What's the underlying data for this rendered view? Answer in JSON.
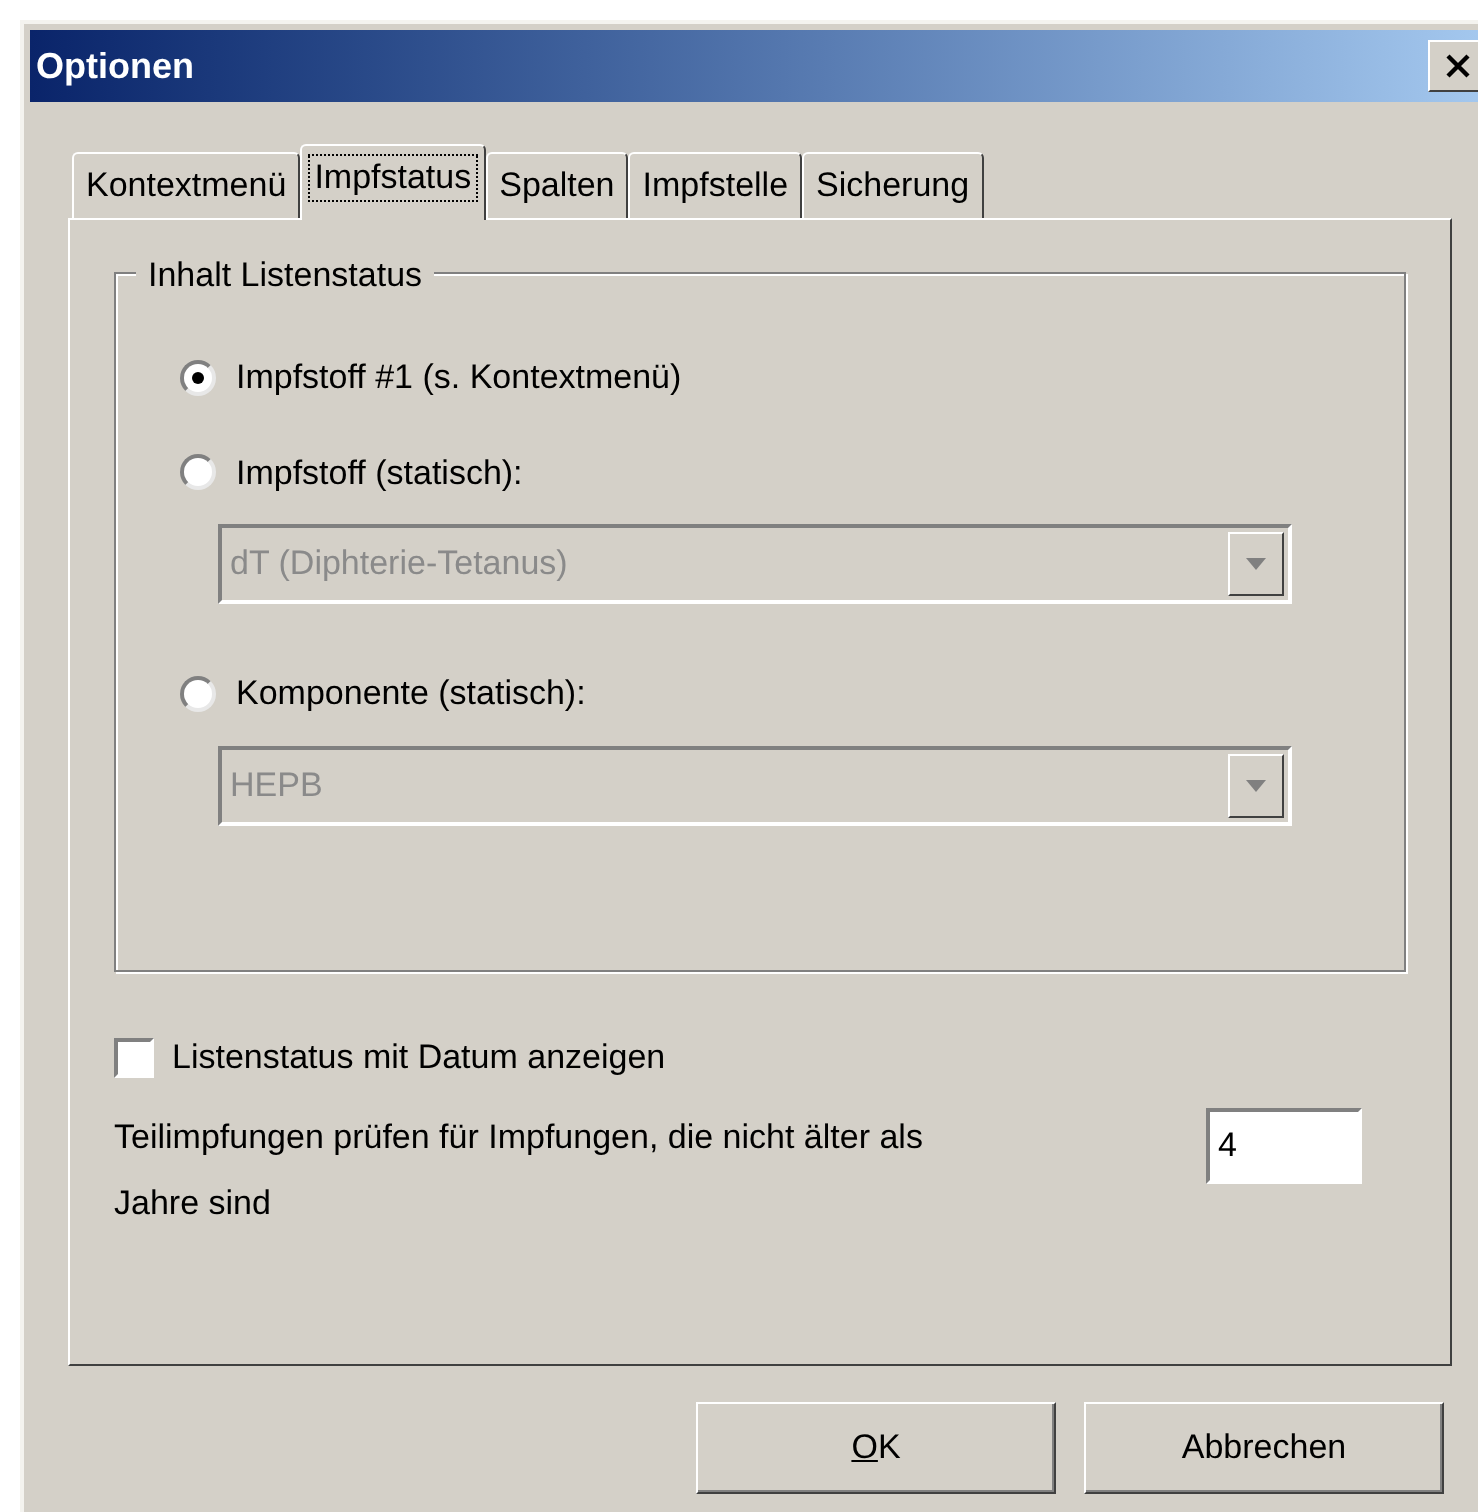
{
  "window": {
    "title": "Optionen"
  },
  "tabs": [
    {
      "label": "Kontextmenü",
      "selected": false
    },
    {
      "label": "Impfstatus",
      "selected": true
    },
    {
      "label": "Spalten",
      "selected": false
    },
    {
      "label": "Impfstelle",
      "selected": false
    },
    {
      "label": "Sicherung",
      "selected": false
    }
  ],
  "group": {
    "legend": "Inhalt Listenstatus",
    "options": [
      {
        "label": "Impfstoff #1 (s. Kontextmenü)",
        "selected": true
      },
      {
        "label": "Impfstoff (statisch):",
        "selected": false,
        "dropdown": {
          "value": "dT (Diphterie-Tetanus)",
          "disabled": true
        }
      },
      {
        "label": "Komponente (statisch):",
        "selected": false,
        "dropdown": {
          "value": "HEPB",
          "disabled": true
        }
      }
    ]
  },
  "checkbox": {
    "label": "Listenstatus mit Datum anzeigen",
    "checked": false
  },
  "years_field": {
    "label": "Teilimpfungen prüfen für Impfungen, die nicht älter als",
    "value": "4",
    "suffix": "Jahre sind"
  },
  "buttons": [
    {
      "label": "OK",
      "underline_first": true
    },
    {
      "label": "Abbrechen",
      "underline_first": false
    }
  ]
}
